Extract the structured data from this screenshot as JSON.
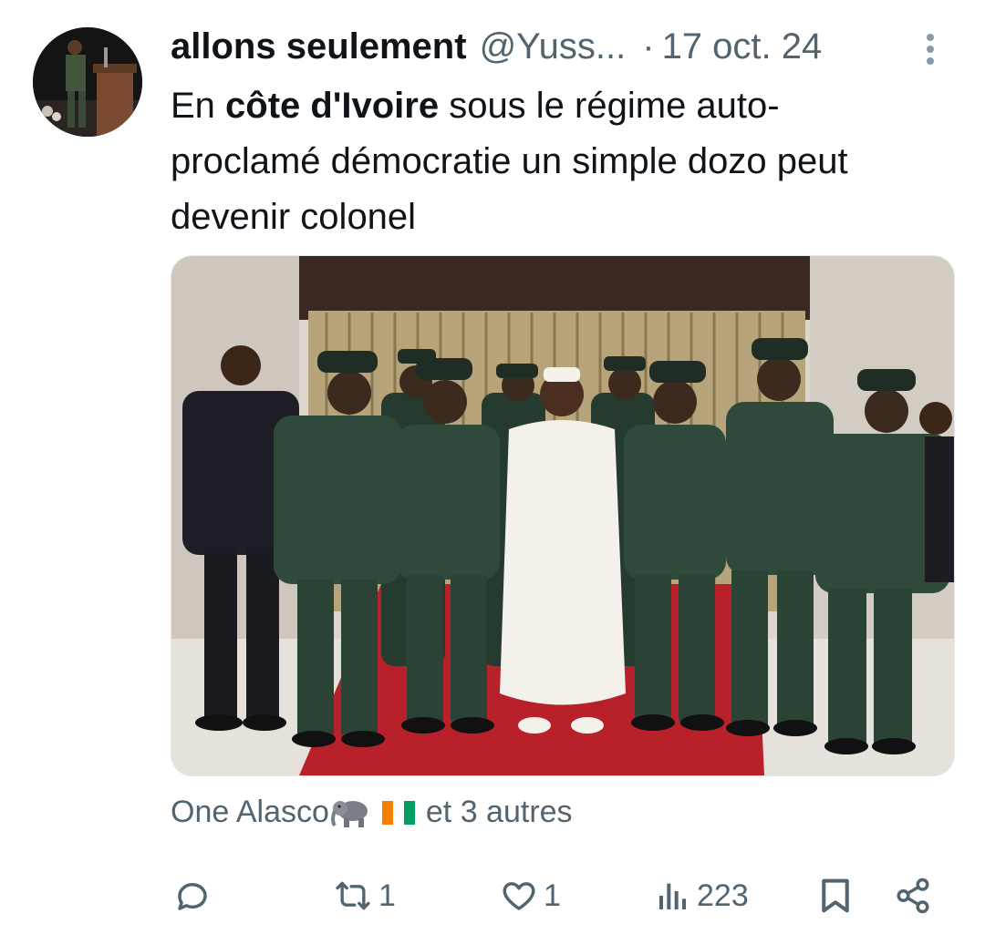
{
  "tweet": {
    "display_name": "allons seulement",
    "handle": "@Yuss...",
    "separator": "·",
    "date": "17 oct. 24",
    "text_before": "En ",
    "text_bold": "côte d'Ivoire",
    "text_after": " sous le régime auto-proclamé démocratie un simple dozo peut devenir colonel"
  },
  "liked_by": {
    "name": "One Alasco",
    "emojis": [
      "elephant-emoji",
      "ivory-coast-flag-emoji"
    ],
    "suffix": "et 3 autres"
  },
  "actions": {
    "reply_count": "",
    "retweet_count": "1",
    "like_count": "1",
    "views_count": "223"
  },
  "icons": [
    "more-vertical-icon",
    "reply-icon",
    "retweet-icon",
    "like-icon",
    "views-icon",
    "bookmark-icon",
    "share-icon"
  ],
  "colors": {
    "text_primary": "#0f1419",
    "text_secondary": "#536471",
    "background": "#ffffff",
    "uniform_green": "#2f4a3a",
    "carpet_red": "#b8202a"
  }
}
